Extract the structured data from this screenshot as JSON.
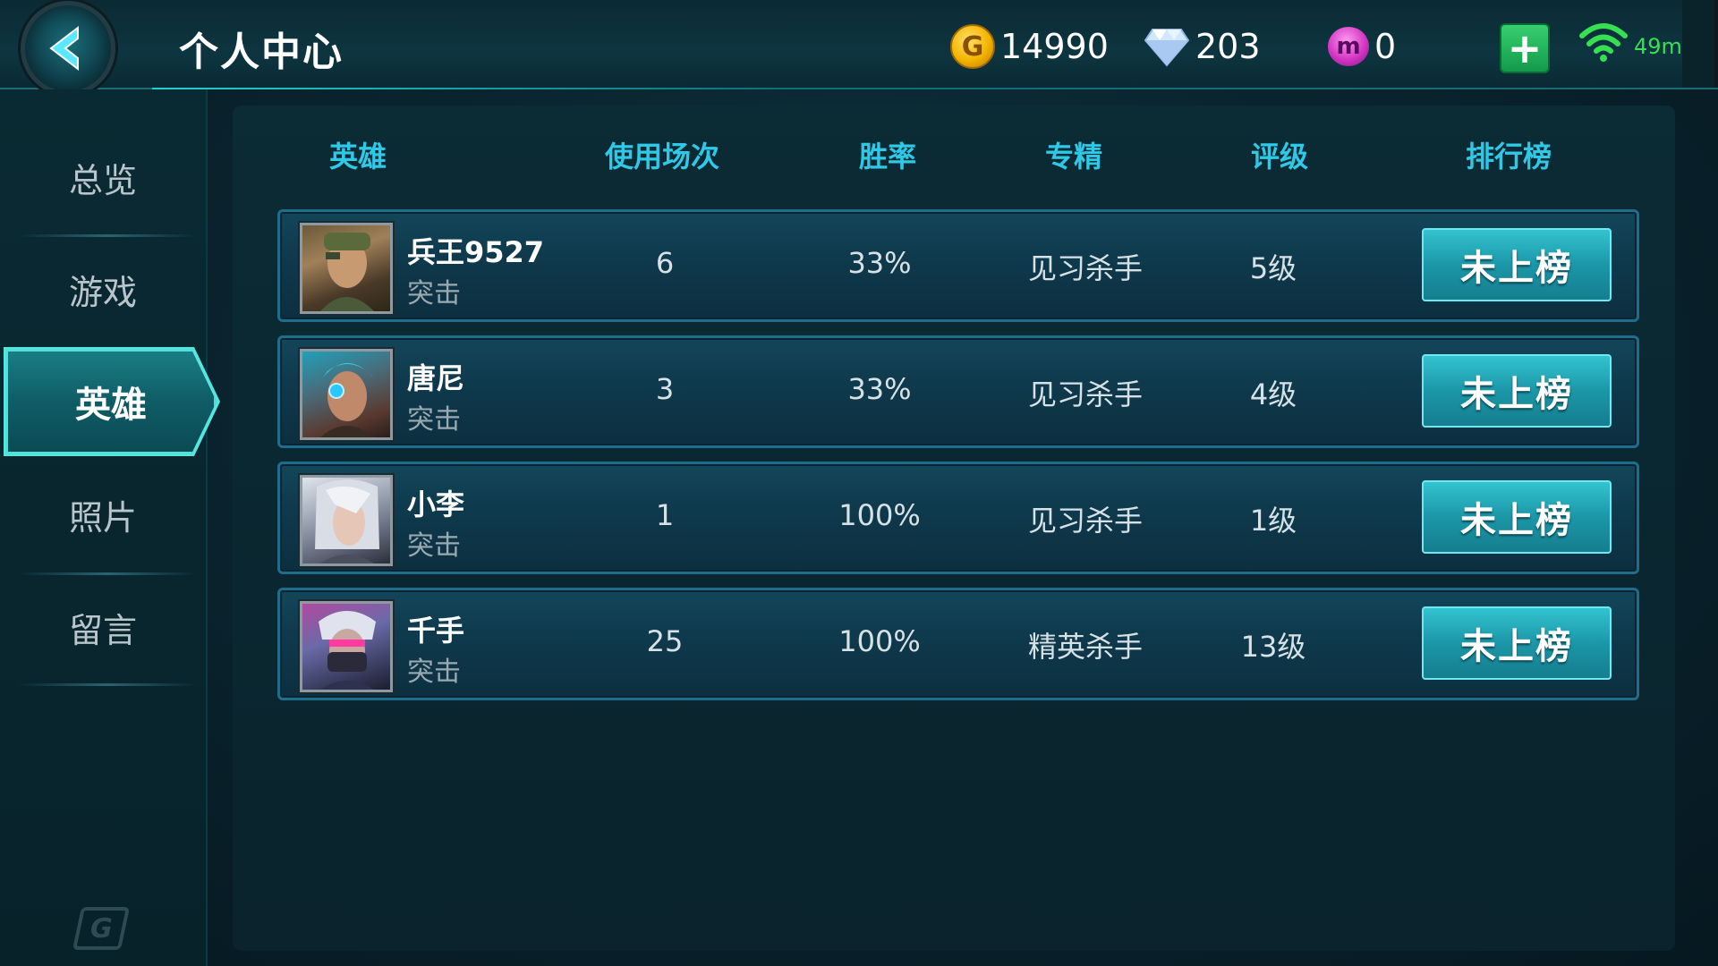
{
  "header": {
    "title": "个人中心",
    "gold": "14990",
    "diamonds": "203",
    "gems": "0",
    "ping": "49ms",
    "colors": {
      "accent": "#1fd2d6",
      "gold": "#f4b400",
      "ping": "#37e052"
    }
  },
  "sidebar": {
    "items": [
      {
        "label": "总览"
      },
      {
        "label": "游戏"
      },
      {
        "label": "英雄"
      },
      {
        "label": "照片"
      },
      {
        "label": "留言"
      }
    ],
    "active": "英雄"
  },
  "table": {
    "columns": [
      "英雄",
      "使用场次",
      "胜率",
      "专精",
      "评级",
      "排行榜"
    ],
    "rows": [
      {
        "name": "兵王9527",
        "role": "突击",
        "matches": "6",
        "win_rate": "33%",
        "specialty": "见习杀手",
        "level": "5级",
        "ranking": "未上榜"
      },
      {
        "name": "唐尼",
        "role": "突击",
        "matches": "3",
        "win_rate": "33%",
        "specialty": "见习杀手",
        "level": "4级",
        "ranking": "未上榜"
      },
      {
        "name": "小李",
        "role": "突击",
        "matches": "1",
        "win_rate": "100%",
        "specialty": "见习杀手",
        "level": "1级",
        "ranking": "未上榜"
      },
      {
        "name": "千手",
        "role": "突击",
        "matches": "25",
        "win_rate": "100%",
        "specialty": "精英杀手",
        "level": "13级",
        "ranking": "未上榜"
      }
    ]
  }
}
